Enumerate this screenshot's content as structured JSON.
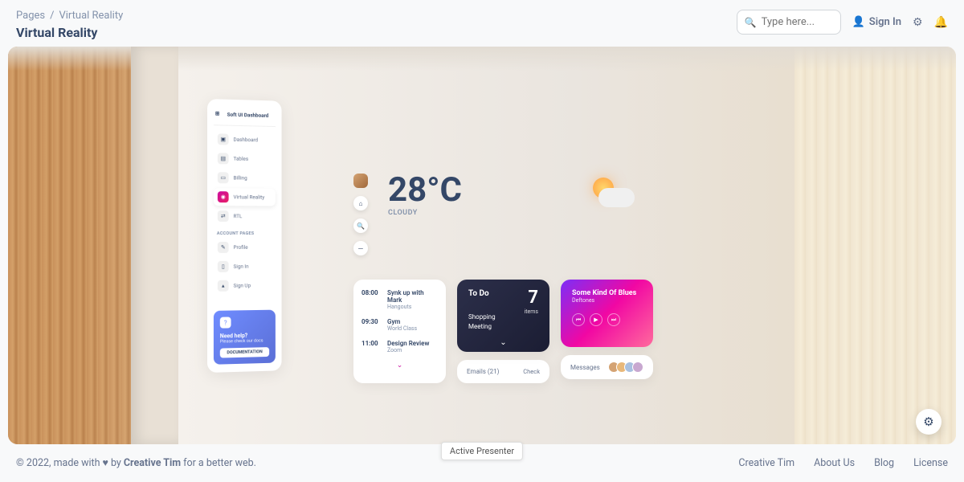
{
  "breadcrumb": {
    "root": "Pages",
    "current": "Virtual Reality"
  },
  "page_title": "Virtual Reality",
  "search": {
    "placeholder": "Type here..."
  },
  "signin": "Sign In",
  "sidebar": {
    "brand": "Soft UI Dashboard",
    "items": [
      {
        "label": "Dashboard"
      },
      {
        "label": "Tables"
      },
      {
        "label": "Billing"
      },
      {
        "label": "Virtual Reality"
      },
      {
        "label": "RTL"
      }
    ],
    "section_label": "ACCOUNT PAGES",
    "account_items": [
      {
        "label": "Profile"
      },
      {
        "label": "Sign In"
      },
      {
        "label": "Sign Up"
      }
    ],
    "help": {
      "title": "Need help?",
      "subtitle": "Please check our docs",
      "button": "DOCUMENTATION"
    }
  },
  "weather": {
    "temperature": "28°C",
    "condition": "CLOUDY"
  },
  "schedule": [
    {
      "time": "08:00",
      "title": "Synk up with Mark",
      "sub": "Hangouts"
    },
    {
      "time": "09:30",
      "title": "Gym",
      "sub": "World Class"
    },
    {
      "time": "11:00",
      "title": "Design Review",
      "sub": "Zoom"
    }
  ],
  "todo": {
    "title": "To Do",
    "count": "7",
    "items_label": "items",
    "items": [
      "Shopping",
      "Meeting"
    ]
  },
  "emails": {
    "label": "Emails (21)",
    "action": "Check"
  },
  "music": {
    "title": "Some Kind Of Blues",
    "artist": "Deftones"
  },
  "messages": {
    "label": "Messages"
  },
  "footer": {
    "copyright_prefix": "© 2022, made with",
    "by": "by",
    "author": "Creative Tim",
    "suffix": "for a better web.",
    "links": [
      "Creative Tim",
      "About Us",
      "Blog",
      "License"
    ]
  },
  "presenter": "Active Presenter"
}
